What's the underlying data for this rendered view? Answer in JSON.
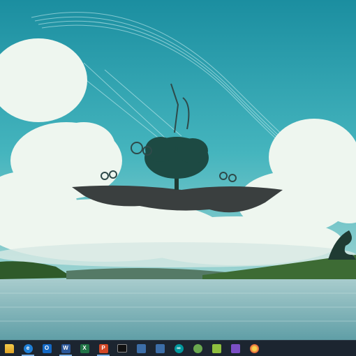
{
  "wallpaper": {
    "description_colors": {
      "sky_top": "#1b8ea0",
      "sky_mid": "#3fb2bd",
      "cloud": "#eef6ef",
      "water": "#8fbcc0",
      "hills": "#2f5a2a"
    }
  },
  "taskbar": {
    "background": "#1c2530",
    "accent": "#7fb2e6",
    "items": [
      {
        "name": "file-explorer",
        "icon": "folder-icon",
        "glyph": "",
        "active": false
      },
      {
        "name": "edge",
        "icon": "edge-icon",
        "glyph": "e",
        "active": true
      },
      {
        "name": "outlook",
        "icon": "outlook-icon",
        "glyph": "O",
        "active": false
      },
      {
        "name": "word",
        "icon": "word-icon",
        "glyph": "W",
        "active": true
      },
      {
        "name": "excel",
        "icon": "excel-icon",
        "glyph": "X",
        "active": false
      },
      {
        "name": "powerpoint",
        "icon": "powerpoint-icon",
        "glyph": "P",
        "active": true
      },
      {
        "name": "terminal",
        "icon": "terminal-icon",
        "glyph": ">_",
        "active": false
      },
      {
        "name": "remote-desktop",
        "icon": "monitor-icon",
        "glyph": "",
        "active": false
      },
      {
        "name": "network-app",
        "icon": "network-icon",
        "glyph": "",
        "active": false
      },
      {
        "name": "arduino",
        "icon": "arduino-icon",
        "glyph": "∞",
        "active": false
      },
      {
        "name": "robot-app",
        "icon": "robot-icon",
        "glyph": "",
        "active": false
      },
      {
        "name": "notepad",
        "icon": "notepad-icon",
        "glyph": "",
        "active": false
      },
      {
        "name": "visual-studio",
        "icon": "visual-studio-icon",
        "glyph": "",
        "active": false
      },
      {
        "name": "browser",
        "icon": "browser-icon",
        "glyph": "",
        "active": false
      }
    ]
  }
}
